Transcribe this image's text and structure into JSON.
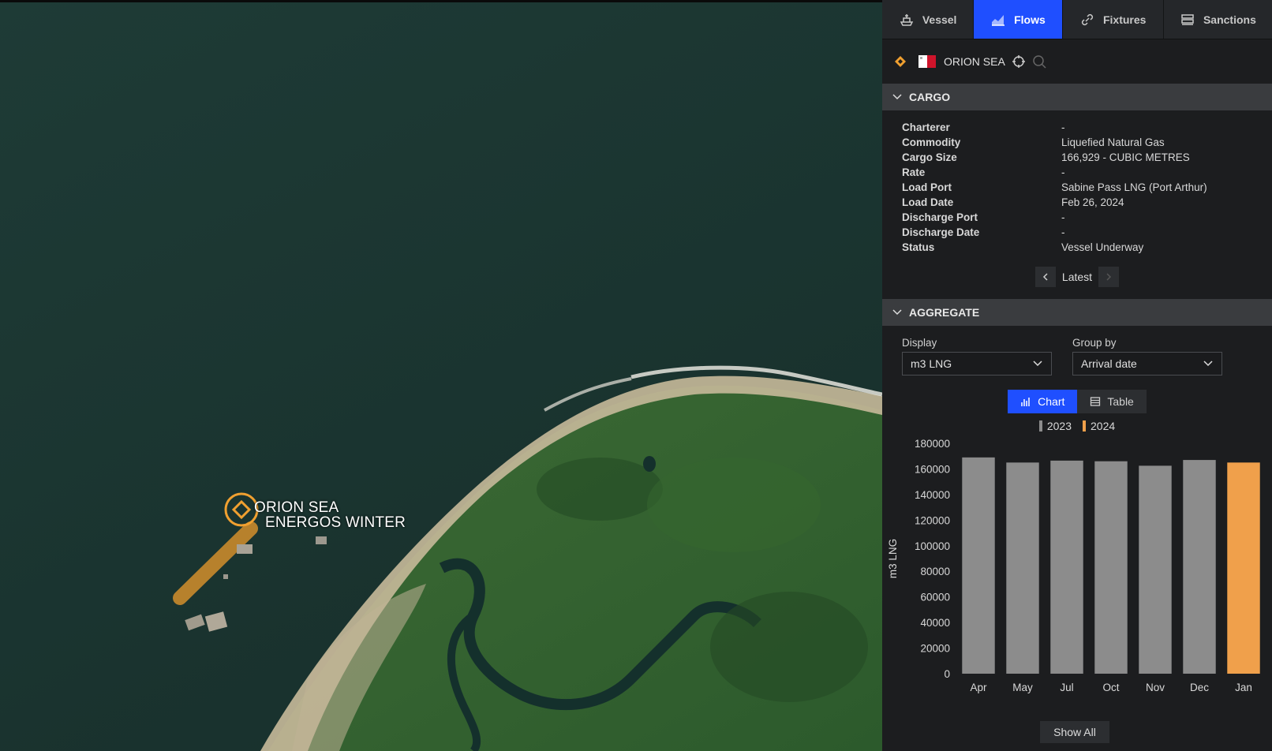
{
  "map": {
    "vessel_label_1": "ORION SEA",
    "vessel_label_2": "ENERGOS WINTER"
  },
  "tabs": [
    {
      "label": "Vessel",
      "icon": "ship-icon"
    },
    {
      "label": "Flows",
      "icon": "area-chart-icon",
      "active": true
    },
    {
      "label": "Fixtures",
      "icon": "link-icon"
    },
    {
      "label": "Sanctions",
      "icon": "list-icon"
    }
  ],
  "vessel": {
    "name": "ORION SEA"
  },
  "cargo": {
    "header": "CARGO",
    "rows": [
      {
        "key": "Charterer",
        "value": "-"
      },
      {
        "key": "Commodity",
        "value": "Liquefied Natural Gas"
      },
      {
        "key": "Cargo Size",
        "value": "166,929 - CUBIC METRES"
      },
      {
        "key": "Rate",
        "value": "-"
      },
      {
        "key": "Load Port",
        "value": "Sabine Pass LNG (Port Arthur)"
      },
      {
        "key": "Load Date",
        "value": "Feb 26, 2024"
      },
      {
        "key": "Discharge Port",
        "value": "-"
      },
      {
        "key": "Discharge Date",
        "value": "-"
      },
      {
        "key": "Status",
        "value": "Vessel Underway"
      }
    ],
    "pager_label": "Latest"
  },
  "aggregate": {
    "header": "AGGREGATE",
    "display_label": "Display",
    "display_value": "m3 LNG",
    "group_label": "Group by",
    "group_value": "Arrival date",
    "chart_btn": "Chart",
    "table_btn": "Table",
    "show_all": "Show All"
  },
  "colors": {
    "accent": "#1f4fff",
    "series_2023": "#8c8c8c",
    "series_2024": "#f0a04b"
  },
  "chart_data": {
    "type": "bar",
    "categories": [
      "Apr",
      "May",
      "Jul",
      "Oct",
      "Nov",
      "Dec",
      "Jan"
    ],
    "series": [
      {
        "name": "2023",
        "values": [
          169000,
          165000,
          166500,
          166000,
          162500,
          167000,
          null
        ]
      },
      {
        "name": "2024",
        "values": [
          null,
          null,
          null,
          null,
          null,
          null,
          165000
        ]
      }
    ],
    "ylabel": "m3 LNG",
    "ylim": [
      0,
      180000
    ],
    "yticks": [
      "180000",
      "160000",
      "140000",
      "120000",
      "100000",
      "80000",
      "60000",
      "40000",
      "20000",
      "0"
    ],
    "legend": "top"
  }
}
